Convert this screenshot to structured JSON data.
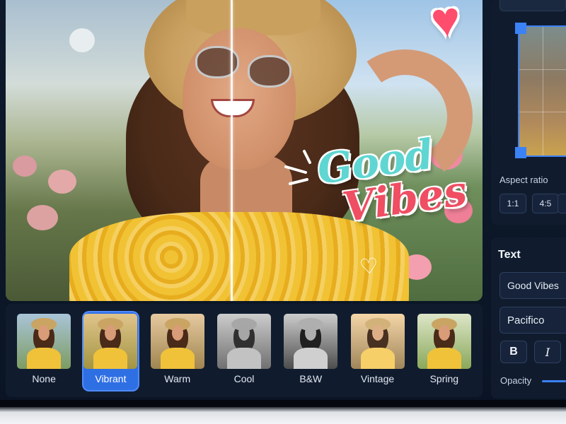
{
  "canvas": {
    "overlay_text_line1": "Good",
    "overlay_text_line2": "Vibes",
    "doodle": "♡",
    "sticker": "heart-sticker"
  },
  "filters": [
    {
      "label": "None",
      "active": false
    },
    {
      "label": "Vibrant",
      "active": true
    },
    {
      "label": "Warm",
      "active": false
    },
    {
      "label": "Cool",
      "active": false
    },
    {
      "label": "B&W",
      "active": false
    },
    {
      "label": "Vintage",
      "active": false
    },
    {
      "label": "Spring",
      "active": false
    }
  ],
  "crop": {
    "aspect_label": "Aspect ratio",
    "aspect_options": [
      "1:1",
      "4:5",
      ""
    ]
  },
  "text_panel": {
    "title": "Text",
    "text_value": "Good Vibes",
    "font_value": "Pacifico",
    "bold_label": "B",
    "italic_label": "I",
    "opacity_label": "Opacity"
  },
  "colors": {
    "accent": "#2f6fe4",
    "panel_bg": "#101c2e",
    "overlay_teal": "#5fd6d2",
    "overlay_red": "#ef4e63"
  }
}
